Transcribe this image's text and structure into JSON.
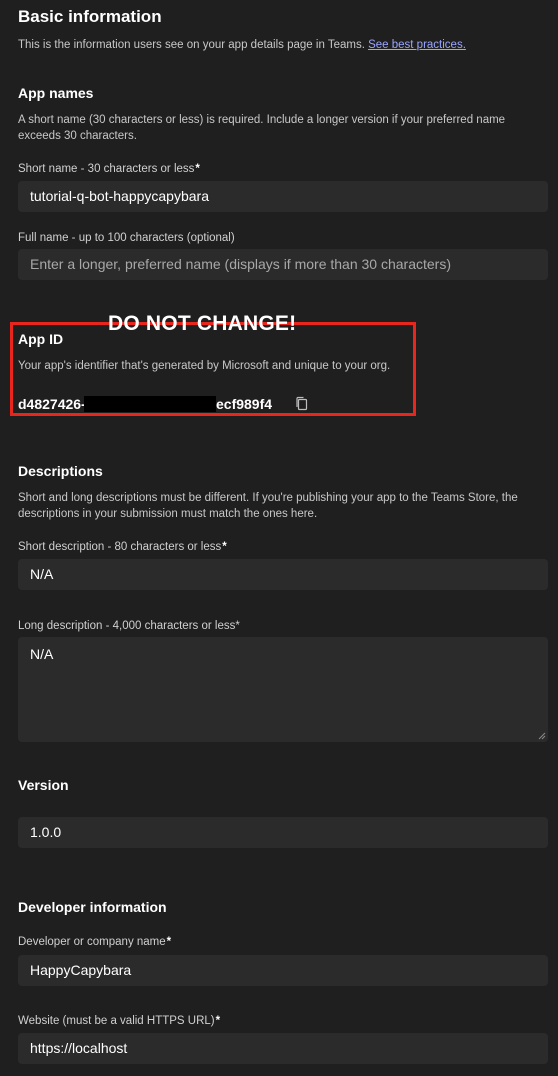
{
  "basic": {
    "title": "Basic information",
    "subtitle_prefix": "This is the information users see on your app details page in Teams. ",
    "subtitle_link": "See best practices."
  },
  "app_names": {
    "heading": "App names",
    "description": "A short name (30 characters or less) is required. Include a longer version if your preferred name exceeds 30 characters.",
    "short_label": "Short name - 30 characters or less",
    "short_value": "tutorial-q-bot-happycapybara",
    "full_label": "Full name - up to 100 characters (optional)",
    "full_placeholder": "Enter a longer, preferred name (displays if more than 30 characters)"
  },
  "annotation": {
    "warning": "DO NOT CHANGE!"
  },
  "app_id": {
    "heading": "App ID",
    "description": "Your app's identifier that's generated by Microsoft and unique to your org.",
    "value_start": "d4827426-",
    "value_end": "ecf989f4",
    "copy_icon": "copy-icon"
  },
  "descriptions": {
    "heading": "Descriptions",
    "description": "Short and long descriptions must be different. If you're publishing your app to the Teams Store, the descriptions in your submission must match the ones here.",
    "short_label": "Short description - 80 characters or less",
    "short_value": "N/A",
    "long_label": "Long description - 4,000 characters or less",
    "long_value": "N/A"
  },
  "version": {
    "heading": "Version",
    "value": "1.0.0"
  },
  "developer": {
    "heading": "Developer information",
    "name_label": "Developer or company name",
    "name_value": "HappyCapybara",
    "website_label": "Website (must be a valid HTTPS URL)",
    "website_value": "https://localhost"
  },
  "required_mark": "*",
  "colors": {
    "accent_red": "#e8261d",
    "link": "#9aa6ff",
    "background": "#1f1f1f",
    "field": "#2b2b2b"
  }
}
